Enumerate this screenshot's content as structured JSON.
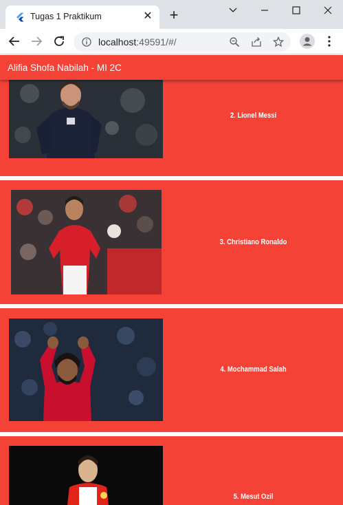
{
  "browser": {
    "tab_title": "Tugas 1 Praktikum",
    "url_host": "localhost",
    "url_rest": ":49591/#/"
  },
  "app": {
    "title": "Alifia Shofa Nabilah - MI 2C"
  },
  "players": [
    {
      "label": "2. Lionel Messi",
      "photo": "messi-photo"
    },
    {
      "label": "3. Christiano Ronaldo",
      "photo": "ronaldo-photo"
    },
    {
      "label": "4. Mochammad Salah",
      "photo": "salah-photo"
    },
    {
      "label": "5. Mesut Ozil",
      "photo": "ozil-photo"
    }
  ],
  "colors": {
    "accent": "#f44336",
    "tab_strip": "#dee1e6"
  },
  "icons": [
    "flutter-favicon",
    "close-icon",
    "plus-icon",
    "minimize-icon",
    "maximize-icon",
    "window-close-icon",
    "back-arrow-icon",
    "forward-arrow-icon",
    "reload-icon",
    "info-icon",
    "zoom-icon",
    "share-icon",
    "star-icon",
    "profile-icon",
    "menu-dots-icon"
  ]
}
